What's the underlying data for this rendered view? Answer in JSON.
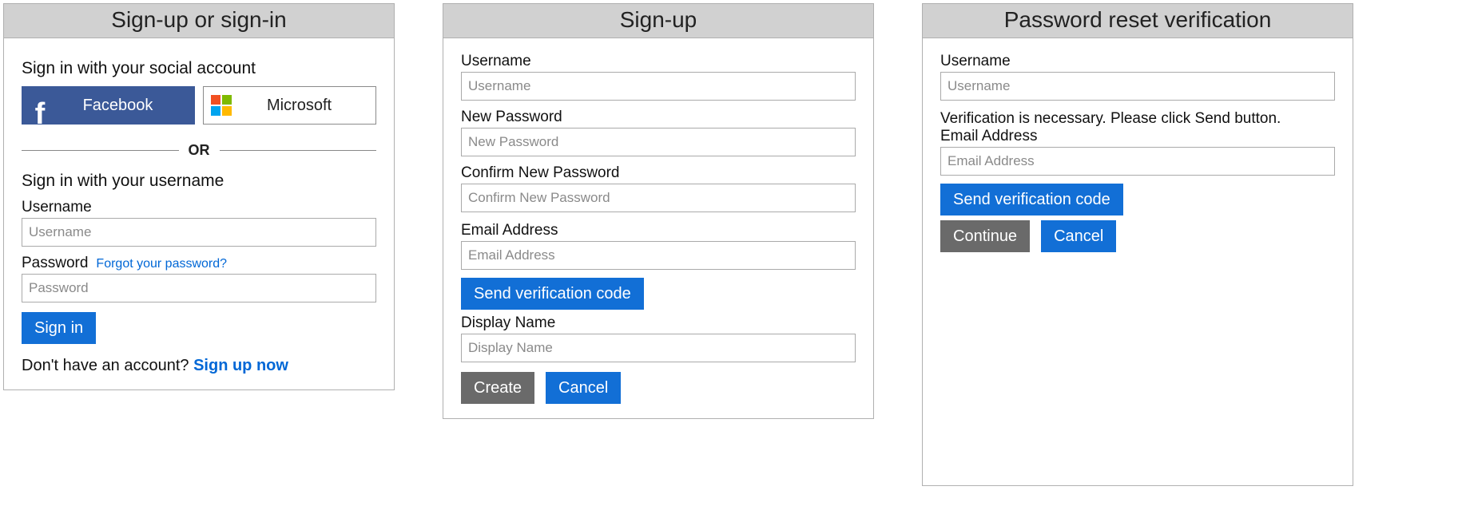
{
  "signin": {
    "title": "Sign-up or sign-in",
    "social_heading": "Sign in with your social account",
    "facebook_label": "Facebook",
    "microsoft_label": "Microsoft",
    "or_label": "OR",
    "local_heading": "Sign in with your username",
    "username_label": "Username",
    "username_placeholder": "Username",
    "password_label": "Password",
    "forgot_link": "Forgot your password?",
    "password_placeholder": "Password",
    "signin_button": "Sign in",
    "no_account_text": "Don't have an account? ",
    "signup_link": "Sign up now"
  },
  "signup": {
    "title": "Sign-up",
    "username_label": "Username",
    "username_placeholder": "Username",
    "newpw_label": "New Password",
    "newpw_placeholder": "New Password",
    "confirmpw_label": "Confirm New Password",
    "confirmpw_placeholder": "Confirm New Password",
    "email_label": "Email Address",
    "email_placeholder": "Email Address",
    "send_code_button": "Send verification code",
    "display_label": "Display Name",
    "display_placeholder": "Display Name",
    "create_button": "Create",
    "cancel_button": "Cancel"
  },
  "reset": {
    "title": "Password reset verification",
    "username_label": "Username",
    "username_placeholder": "Username",
    "info_text": "Verification is necessary. Please click Send button.",
    "email_label": "Email Address",
    "email_placeholder": "Email Address",
    "send_code_button": "Send verification code",
    "continue_button": "Continue",
    "cancel_button": "Cancel"
  }
}
